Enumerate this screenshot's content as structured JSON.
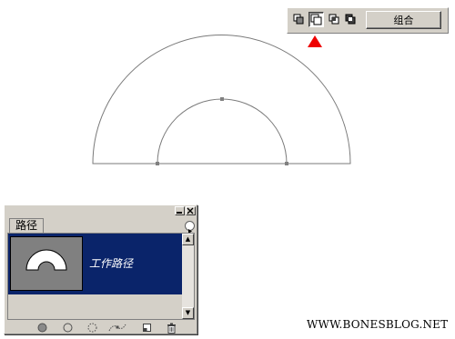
{
  "toolbar": {
    "combine_label": "组合",
    "ops": [
      {
        "icon": "add-to-shape-area-icon",
        "active": false
      },
      {
        "icon": "subtract-from-shape-area-icon",
        "active": true
      },
      {
        "icon": "intersect-shape-areas-icon",
        "active": false
      },
      {
        "icon": "exclude-overlapping-shape-areas-icon",
        "active": false
      }
    ],
    "pointer_color": "#ee0000"
  },
  "palette": {
    "tab_label": "路径",
    "path_item_name": "工作路径",
    "selected_color": "#0a246a",
    "bottom_icons": [
      "fill-path-icon",
      "stroke-path-icon",
      "load-path-as-selection-icon",
      "make-work-path-icon",
      "new-path-icon",
      "delete-path-icon"
    ]
  },
  "watermark": "WWW.BONESBLOG.NET"
}
